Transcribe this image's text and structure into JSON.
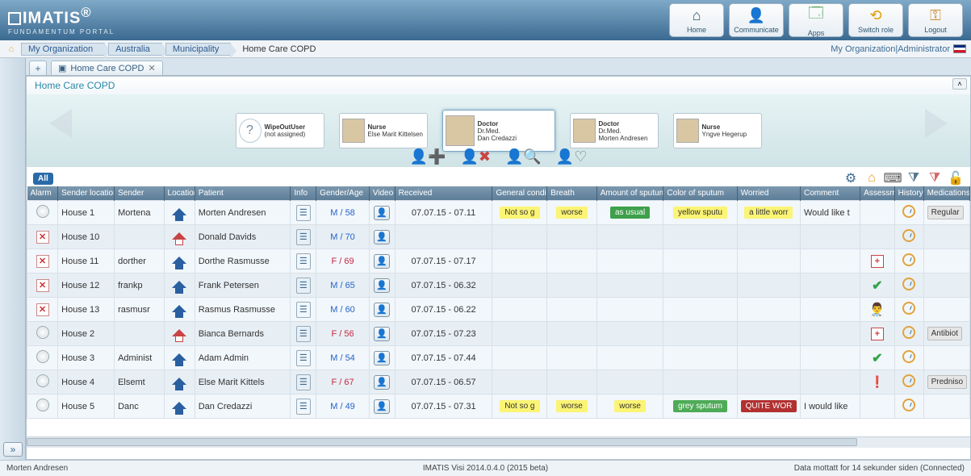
{
  "brand": {
    "name": "IMATIS",
    "tagline": "FUNDAMENTUM PORTAL",
    "reg": "®"
  },
  "topButtons": [
    {
      "label": "Home",
      "icon": "home"
    },
    {
      "label": "Communicate",
      "icon": "comm"
    },
    {
      "label": "Apps",
      "icon": "apps"
    },
    {
      "label": "Switch role",
      "icon": "switch"
    },
    {
      "label": "Logout",
      "icon": "logout"
    }
  ],
  "breadcrumb": {
    "segments": [
      "My Organization",
      "Australia",
      "Municipality"
    ],
    "last": "Home Care COPD",
    "right": "My Organization|Administrator"
  },
  "tab": {
    "title": "Home Care COPD"
  },
  "panel": {
    "title": "Home Care COPD"
  },
  "context": {
    "cards": [
      {
        "role": "WipeOutUser",
        "name": "(not assigned)",
        "icon": "q"
      },
      {
        "role": "Nurse",
        "name": "Else Marit Kittelsen",
        "icon": "av"
      },
      {
        "role": "Doctor",
        "title": "Dr.Med.",
        "name": "Dan Credazzi",
        "icon": "av",
        "active": true
      },
      {
        "role": "Doctor",
        "title": "Dr.Med.",
        "name": "Morten Andresen",
        "icon": "av"
      },
      {
        "role": "Nurse",
        "name": "Yngve Hegerup",
        "icon": "av"
      }
    ]
  },
  "filterChip": "All",
  "columns": [
    "Alarm",
    "Sender location",
    "Sender",
    "Location",
    "Patient",
    "Info",
    "Gender/Age",
    "Video",
    "Received",
    "General conditic",
    "Breath",
    "Amount of sputum",
    "Color of sputum",
    "Worried",
    "Comment",
    "Assessme",
    "History",
    "Medications"
  ],
  "rows": [
    {
      "alarm": "dot",
      "sloc": "House 1",
      "sender": "Mortena",
      "loc": "blue",
      "patient": "Morten Andresen",
      "info": true,
      "ga": "M / 58",
      "vid": true,
      "recv": "07.07.15 - 07.11",
      "gc": "Not so g",
      "breath": "worse",
      "amt": "as usual",
      "amt_style": "green",
      "color": "yellow sputu",
      "worried": "a little worr",
      "comment": "Would like t",
      "assess": "",
      "hist": true,
      "med": "Regular"
    },
    {
      "alarm": "x",
      "sloc": "House 10",
      "sender": "",
      "loc": "red",
      "patient": "Donald Davids",
      "info": true,
      "ga": "M / 70",
      "vid": true,
      "recv": "",
      "gc": "",
      "breath": "",
      "amt": "",
      "color": "",
      "worried": "",
      "comment": "",
      "assess": "",
      "hist": true,
      "med": ""
    },
    {
      "alarm": "x",
      "sloc": "House 11",
      "sender": "dorther",
      "loc": "blue",
      "patient": "Dorthe Rasmusse",
      "info": true,
      "ga": "F / 69",
      "ga_red": true,
      "vid": true,
      "recv": "07.07.15 - 07.17",
      "gc": "",
      "breath": "",
      "amt": "",
      "color": "",
      "worried": "",
      "comment": "",
      "assess": "plus",
      "hist": true,
      "med": ""
    },
    {
      "alarm": "x",
      "sloc": "House 12",
      "sender": "frankp",
      "loc": "blue",
      "patient": "Frank Petersen",
      "info": true,
      "ga": "M / 65",
      "vid": true,
      "recv": "07.07.15 - 06.32",
      "gc": "",
      "breath": "",
      "amt": "",
      "color": "",
      "worried": "",
      "comment": "",
      "assess": "check",
      "hist": true,
      "med": ""
    },
    {
      "alarm": "x",
      "sloc": "House 13",
      "sender": "rasmusr",
      "loc": "blue",
      "patient": "Rasmus Rasmusse",
      "info": true,
      "ga": "M / 60",
      "vid": true,
      "recv": "07.07.15 - 06.22",
      "gc": "",
      "breath": "",
      "amt": "",
      "color": "",
      "worried": "",
      "comment": "",
      "assess": "doc",
      "hist": true,
      "med": ""
    },
    {
      "alarm": "dot",
      "sloc": "House 2",
      "sender": "",
      "loc": "red",
      "patient": "Bianca Bernards",
      "info": true,
      "ga": "F / 56",
      "ga_red": true,
      "vid": true,
      "recv": "07.07.15 - 07.23",
      "gc": "",
      "breath": "",
      "amt": "",
      "color": "",
      "worried": "",
      "comment": "",
      "assess": "plus",
      "hist": true,
      "med": "Antibiot"
    },
    {
      "alarm": "dot",
      "sloc": "House 3",
      "sender": "Administ",
      "loc": "blue",
      "patient": "Adam Admin",
      "info": true,
      "ga": "M / 54",
      "vid": true,
      "recv": "07.07.15 - 07.44",
      "gc": "",
      "breath": "",
      "amt": "",
      "color": "",
      "worried": "",
      "comment": "",
      "assess": "check",
      "hist": true,
      "med": ""
    },
    {
      "alarm": "dot",
      "sloc": "House 4",
      "sender": "Elsemt",
      "loc": "blue",
      "patient": "Else Marit Kittels",
      "info": true,
      "ga": "F / 67",
      "ga_red": true,
      "vid": true,
      "recv": "07.07.15 - 06.57",
      "gc": "",
      "breath": "",
      "amt": "",
      "color": "",
      "worried": "",
      "comment": "",
      "assess": "warn",
      "hist": true,
      "med": "Predniso"
    },
    {
      "alarm": "dot",
      "sloc": "House 5",
      "sender": "Danc",
      "loc": "blue",
      "patient": "Dan Credazzi",
      "info": true,
      "ga": "M / 49",
      "vid": true,
      "recv": "07.07.15 - 07.31",
      "gc": "Not so g",
      "breath": "worse",
      "amt": "worse",
      "amt_style": "yellow",
      "color": "grey sputum",
      "color_style": "green",
      "worried": "QUITE WOR",
      "worried_style": "red",
      "comment": "I would like",
      "assess": "",
      "hist": true,
      "med": ""
    }
  ],
  "status": {
    "left": "Morten Andresen",
    "center": "IMATIS Visi 2014.0.4.0 (2015 beta)",
    "right": "Data mottatt for 14 sekunder siden (Connected)"
  }
}
